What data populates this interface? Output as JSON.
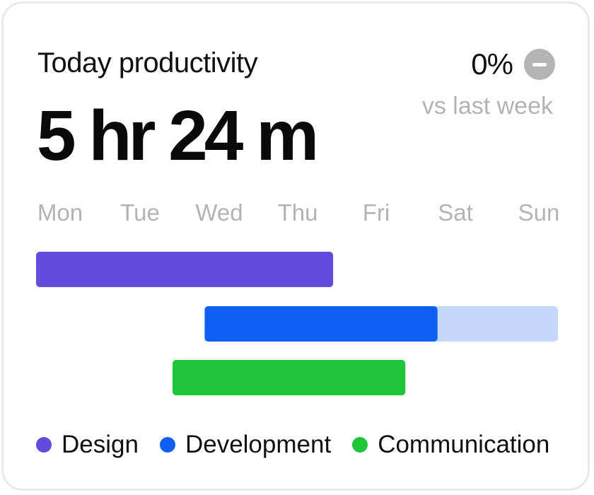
{
  "header": {
    "title": "Today productivity",
    "total_time": "5 hr 24 m",
    "change_value": "0%",
    "change_icon": "minus-circle-icon",
    "change_caption": "vs last week"
  },
  "colors": {
    "design": "#634bdd",
    "development": "#0f5ff5",
    "development_light": "#c5d8fb",
    "communication": "#20c63a",
    "day_label": "#b3b3b3"
  },
  "chart_data": {
    "type": "gantt",
    "days": [
      "Mon",
      "Tue",
      "Wed",
      "Thu",
      "Fri",
      "Sat",
      "Sun"
    ],
    "series": [
      {
        "name": "Design",
        "color": "#634bdd",
        "start": 0.0,
        "end": 3.7,
        "light_end": null
      },
      {
        "name": "Development",
        "color": "#0f5ff5",
        "start": 2.1,
        "end": 5.0,
        "light_end": 6.5
      },
      {
        "name": "Communication",
        "color": "#20c63a",
        "start": 1.7,
        "end": 4.6,
        "light_end": null
      }
    ]
  },
  "legend": [
    {
      "label": "Design",
      "color": "#634bdd"
    },
    {
      "label": "Development",
      "color": "#0f5ff5"
    },
    {
      "label": "Communication",
      "color": "#20c63a"
    }
  ]
}
